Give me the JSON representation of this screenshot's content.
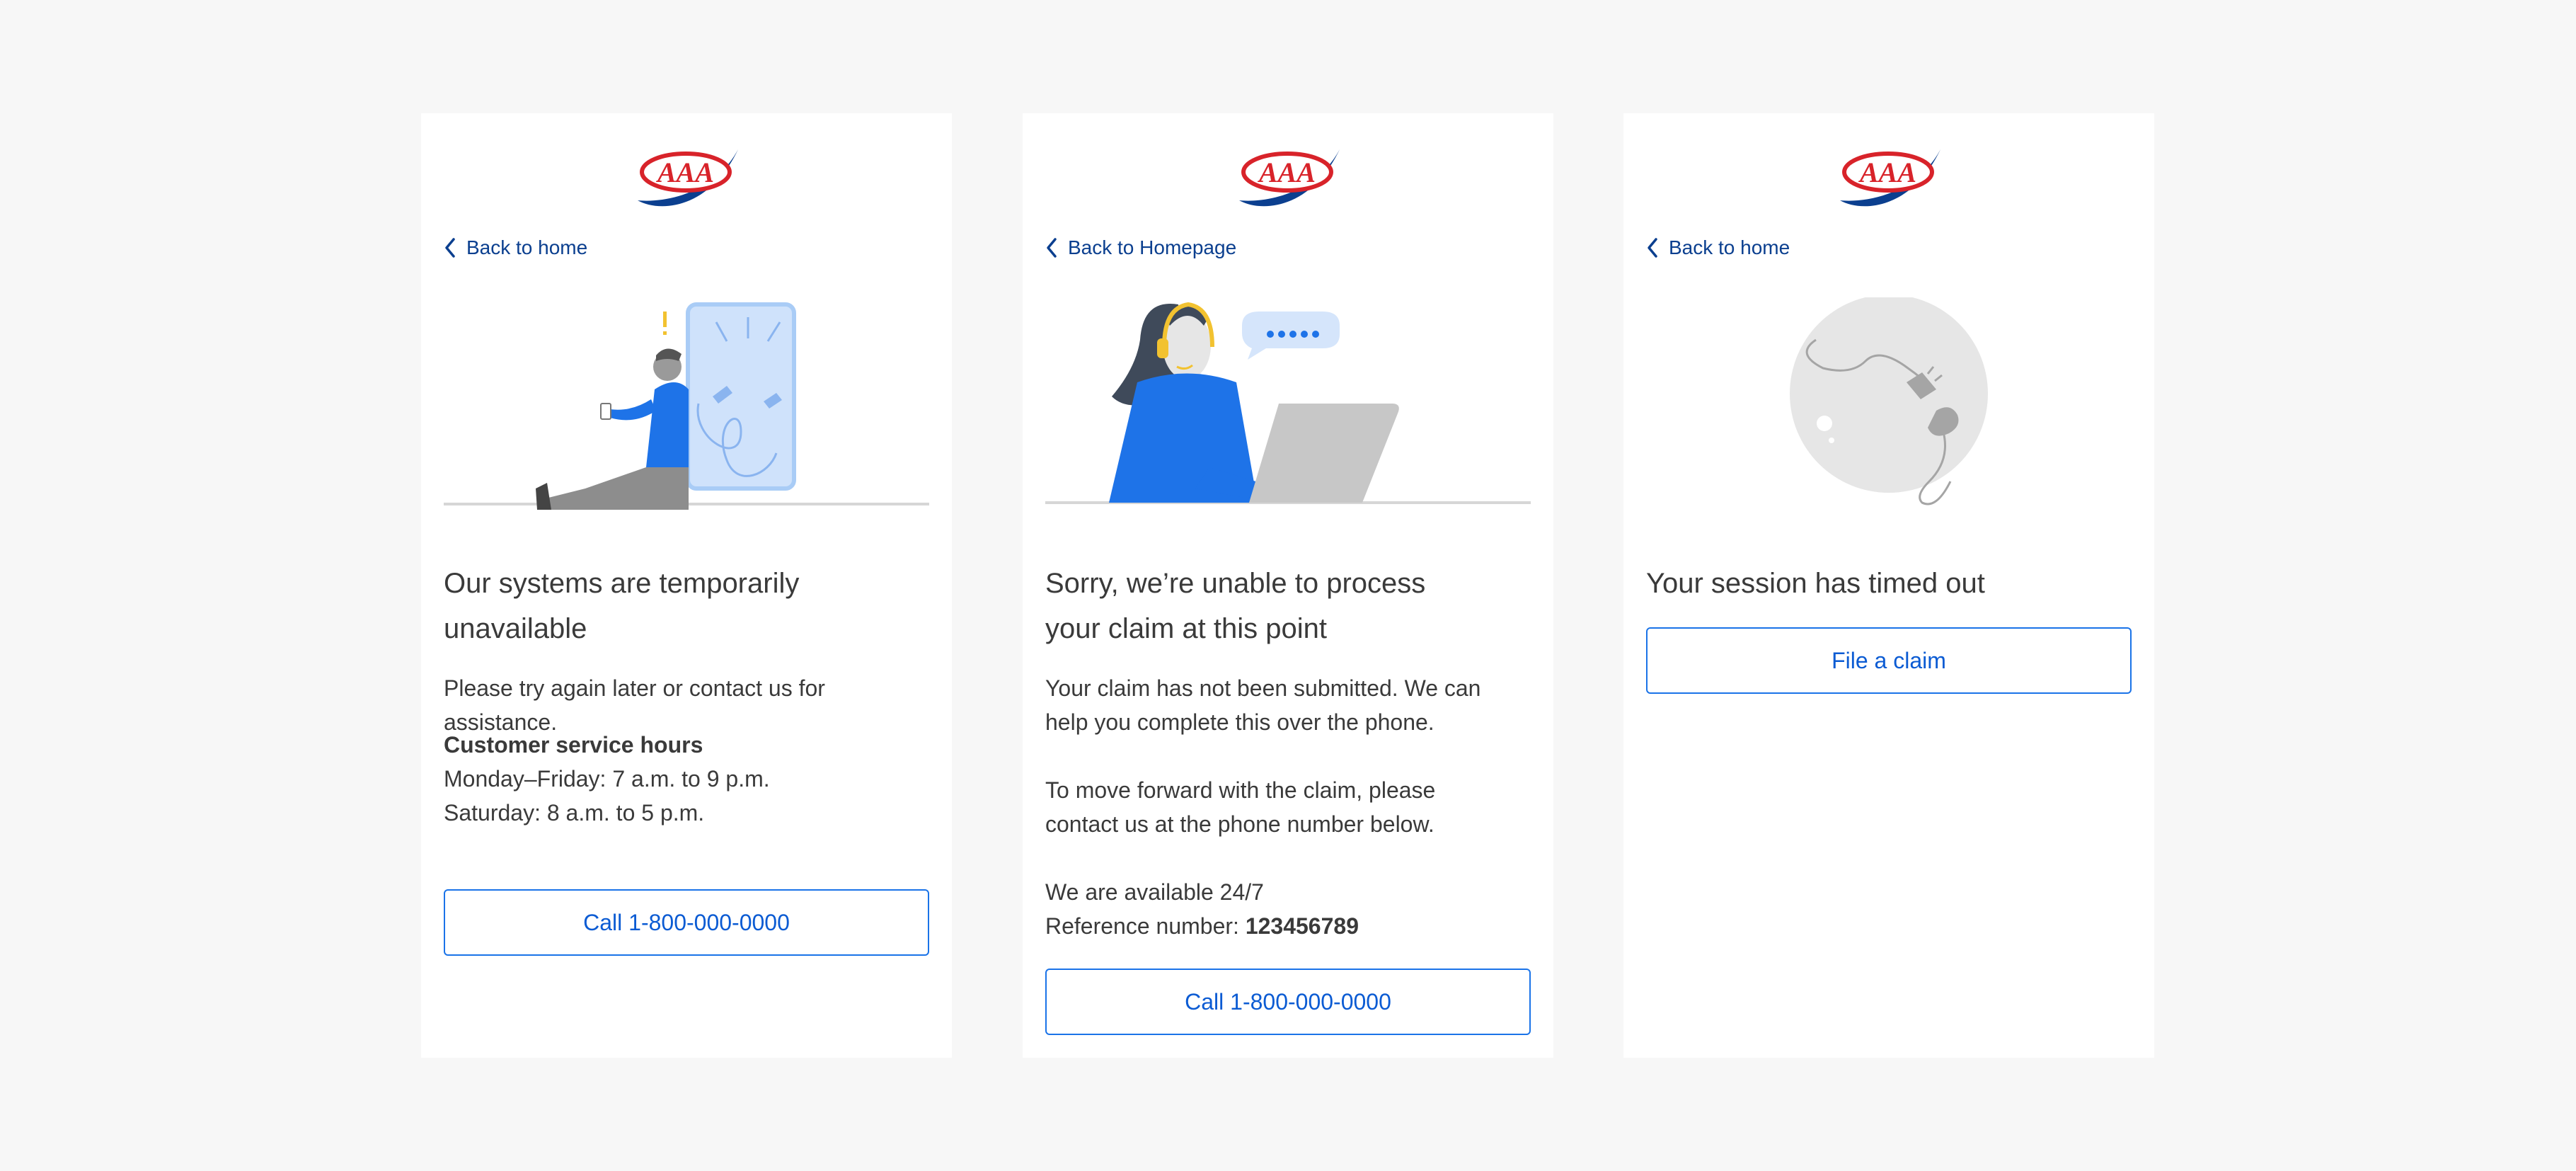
{
  "cards": [
    {
      "back_label": "Back to home",
      "title": "Our systems are temporarily unavailable",
      "paragraph": "Please try again later or contact us for assistance.",
      "hours_heading": "Customer service hours",
      "hours_weekday": "Monday–Friday: 7 a.m. to 9 p.m.",
      "hours_saturday": "Saturday: 8 a.m. to 5 p.m.",
      "button_label": "Call 1-800-000-0000"
    },
    {
      "back_label": "Back to Homepage",
      "title": "Sorry, we’re unable to process your claim at this point",
      "paragraph1": "Your claim has not been submitted. We can help you complete this over the phone.",
      "paragraph2": "To move forward with the claim, please contact us at the phone number below.",
      "availability": "We are available 24/7",
      "reference_label": "Reference number: ",
      "reference_number": "123456789",
      "button_label": "Call 1-800-000-0000"
    },
    {
      "back_label": "Back to home",
      "title": "Your session has timed out",
      "button_label": "File a claim"
    }
  ],
  "logo": {
    "text": "AAA",
    "icon": "aaa-logo"
  },
  "colors": {
    "background": "#f7f7f7",
    "card": "#ffffff",
    "link": "#0b3f8f",
    "button_border": "#1a73e8",
    "button_text": "#0b5bd3",
    "illustration_blue": "#1e73e8",
    "logo_red": "#d8232a",
    "logo_navy": "#0b3f8f"
  }
}
